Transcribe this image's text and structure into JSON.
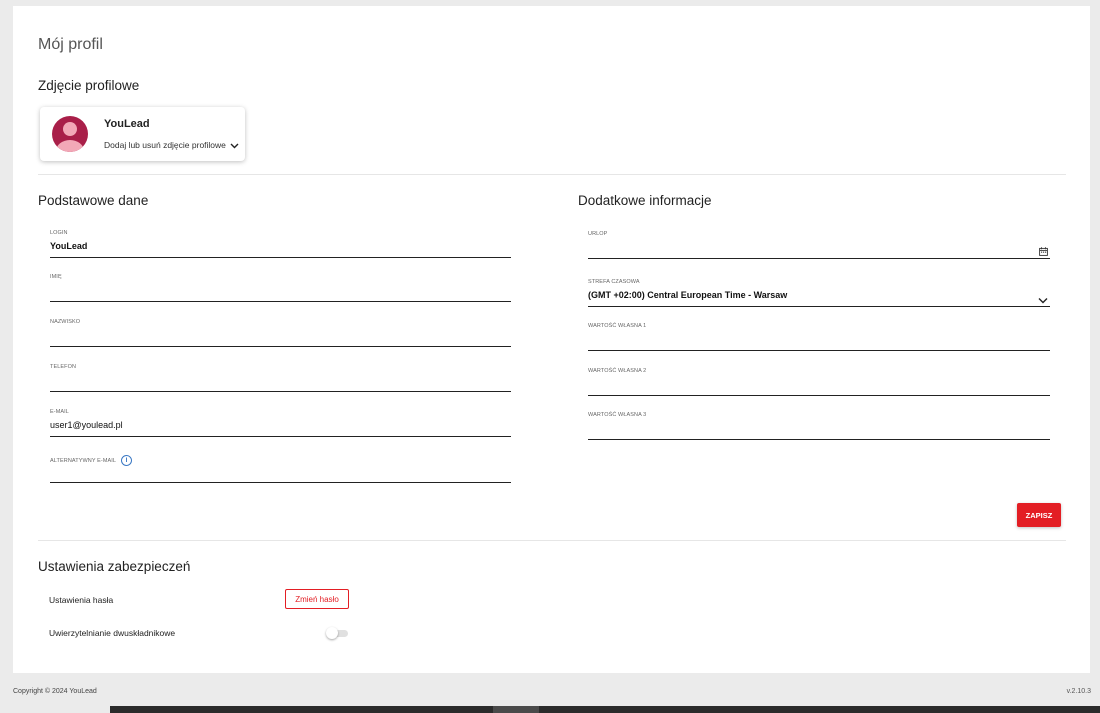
{
  "page": {
    "title": "Mój profil"
  },
  "profile_photo": {
    "heading": "Zdjęcie profilowe",
    "name": "YouLead",
    "action_label": "Dodaj lub usuń zdjęcie profilowe"
  },
  "basic": {
    "heading": "Podstawowe dane",
    "fields": [
      {
        "label": "LOGIN",
        "value": "YouLead"
      },
      {
        "label": "IMIĘ",
        "value": ""
      },
      {
        "label": "NAZWISKO",
        "value": ""
      },
      {
        "label": "TELEFON",
        "value": ""
      },
      {
        "label": "E-MAIL",
        "value": "user1@youlead.pl"
      },
      {
        "label": "ALTERNATYWNY E-MAIL",
        "value": ""
      }
    ]
  },
  "additional": {
    "heading": "Dodatkowe informacje",
    "fields": [
      {
        "label": "URLOP",
        "value": ""
      },
      {
        "label": "STREFA CZASOWA",
        "value": "(GMT +02:00) Central European Time - Warsaw"
      },
      {
        "label": "WARTOŚĆ WŁASNA 1",
        "value": ""
      },
      {
        "label": "WARTOŚĆ WŁASNA 2",
        "value": ""
      },
      {
        "label": "WARTOŚĆ WŁASNA 3",
        "value": ""
      }
    ]
  },
  "save_label": "ZAPISZ",
  "security": {
    "heading": "Ustawienia zabezpieczeń",
    "password_label": "Ustawienia hasła",
    "change_password_label": "Zmień hasło",
    "twofa_label": "Uwierzytelnianie dwuskładnikowe",
    "twofa_enabled": false
  },
  "footer": {
    "copyright": "Copyright © 2024 YouLead",
    "version": "v.2.10.3"
  },
  "colors": {
    "accent": "#e31e24",
    "avatar": "#a91f49",
    "info": "#3a78c4"
  }
}
